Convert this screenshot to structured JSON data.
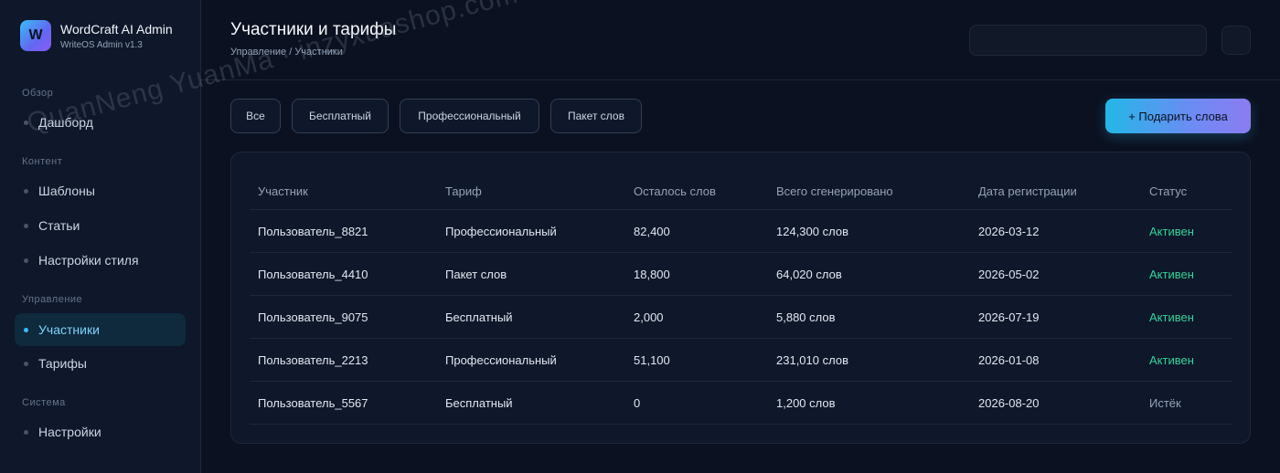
{
  "brand": {
    "logo_letter": "W",
    "title": "WordCraft AI Admin",
    "subtitle": "WriteOS Admin v1.3"
  },
  "sidebar": {
    "groups": [
      {
        "label": "Обзор",
        "items": [
          {
            "label": "Дашборд",
            "active": false
          }
        ]
      },
      {
        "label": "Контент",
        "items": [
          {
            "label": "Шаблоны",
            "active": false
          },
          {
            "label": "Статьи",
            "active": false
          },
          {
            "label": "Настройки стиля",
            "active": false
          }
        ]
      },
      {
        "label": "Управление",
        "items": [
          {
            "label": "Участники",
            "active": true
          },
          {
            "label": "Тарифы",
            "active": false
          }
        ]
      },
      {
        "label": "Система",
        "items": [
          {
            "label": "Настройки",
            "active": false
          }
        ]
      }
    ]
  },
  "header": {
    "title": "Участники и тарифы",
    "breadcrumb": "Управление / Участники",
    "search": {
      "value": "",
      "placeholder": ""
    }
  },
  "filters": [
    "Все",
    "Бесплатный",
    "Профессиональный",
    "Пакет слов"
  ],
  "gift_button_label": "+ Подарить слова",
  "table": {
    "columns": [
      "Участник",
      "Тариф",
      "Осталось слов",
      "Всего сгенерировано",
      "Дата регистрации",
      "Статус"
    ],
    "rows": [
      [
        "Пользователь_8821",
        "Профессиональный",
        "82,400",
        "124,300 слов",
        "2026-03-12",
        "Активен"
      ],
      [
        "Пользователь_4410",
        "Пакет слов",
        "18,800",
        "64,020 слов",
        "2026-05-02",
        "Активен"
      ],
      [
        "Пользователь_9075",
        "Бесплатный",
        "2,000",
        "5,880 слов",
        "2026-07-19",
        "Активен"
      ],
      [
        "Пользователь_2213",
        "Профессиональный",
        "51,100",
        "231,010 слов",
        "2026-01-08",
        "Активен"
      ],
      [
        "Пользователь_5567",
        "Бесплатный",
        "0",
        "1,200 слов",
        "2026-08-20",
        "Истёк"
      ]
    ]
  },
  "watermark": "QuanNeng YuanMa · inzyxuashop.com",
  "colors": {
    "accent": "#38bdf8",
    "active_status": "#34d399",
    "expired_status": "#94a3b8"
  }
}
